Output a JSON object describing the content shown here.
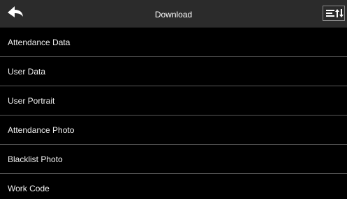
{
  "header": {
    "title": "Download",
    "back_icon": "back-arrow-icon",
    "menu_icon": "menu-sort-icon"
  },
  "items": [
    {
      "label": "Attendance Data"
    },
    {
      "label": "User Data"
    },
    {
      "label": "User Portrait"
    },
    {
      "label": "Attendance Photo"
    },
    {
      "label": "Blacklist Photo"
    },
    {
      "label": "Work Code"
    }
  ],
  "colors": {
    "header_bg": "#2b2b2b",
    "list_bg": "#000000",
    "divider": "#5a5a5a",
    "text": "#f2f2f2"
  }
}
